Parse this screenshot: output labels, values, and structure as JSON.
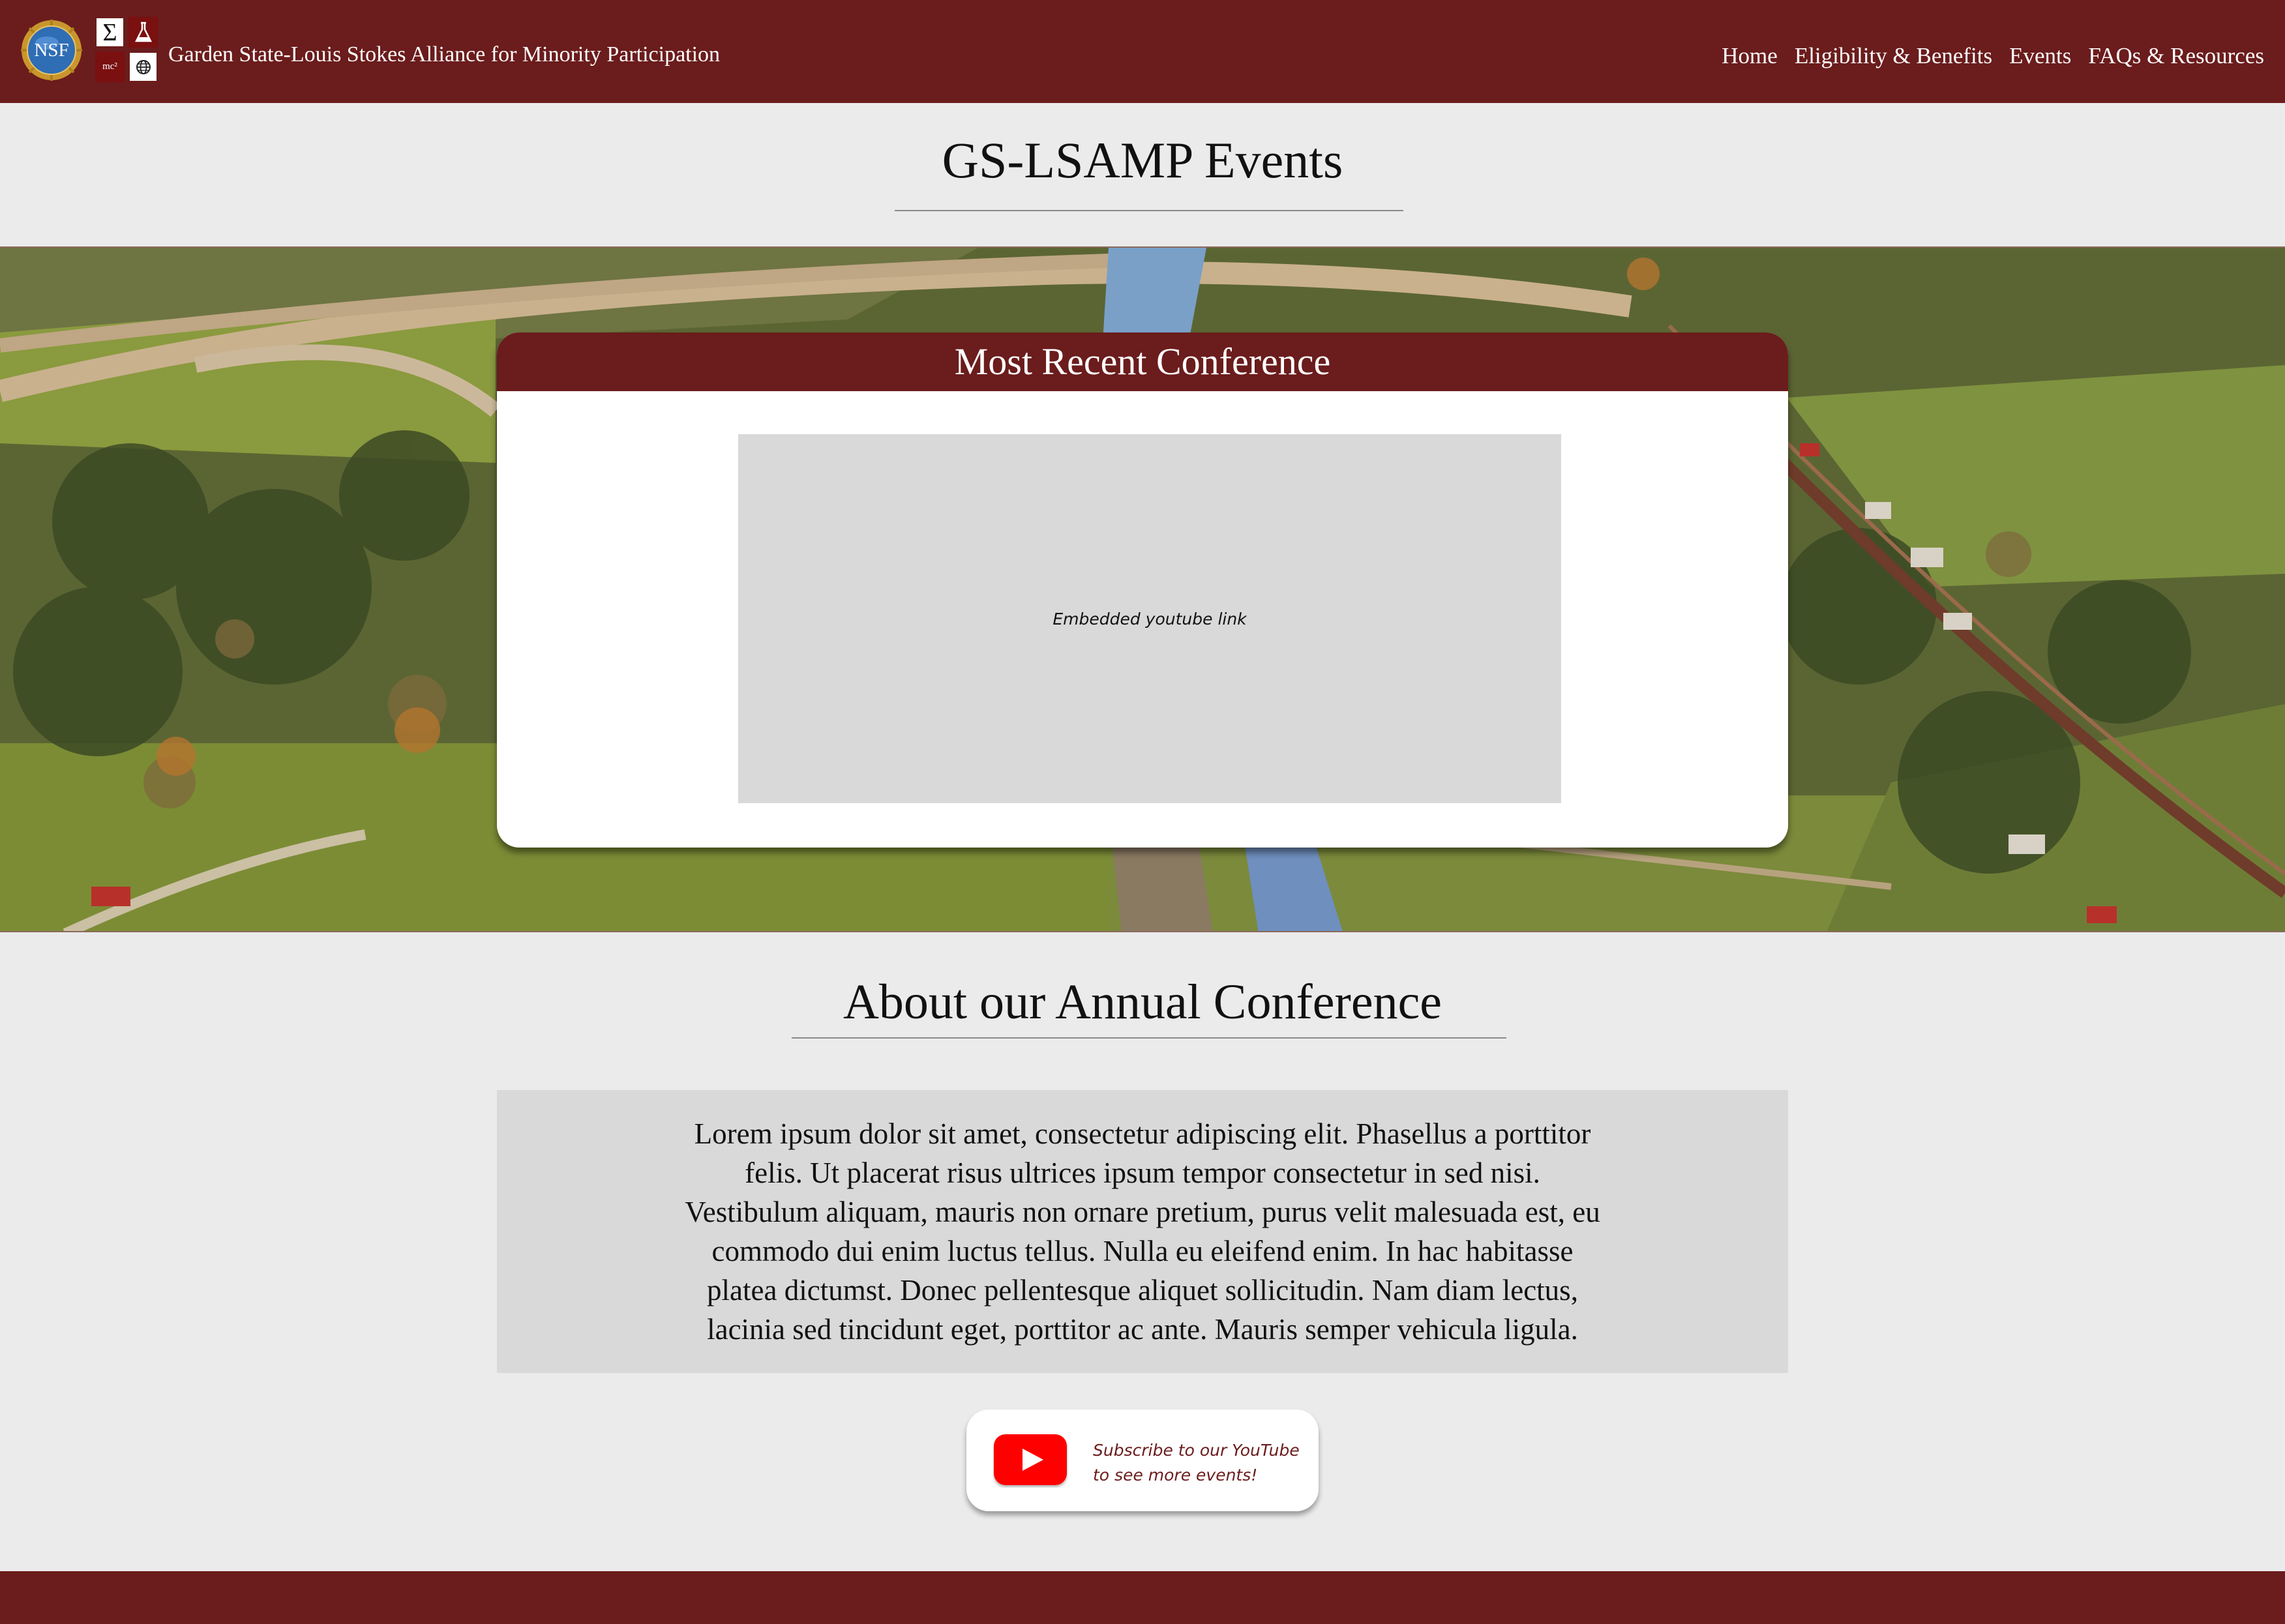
{
  "header": {
    "nsf_logo_text": "NSF",
    "sci_logo": {
      "sigma": "Σ",
      "flask": "⚗",
      "mc2": "mc²",
      "globe": "⊕"
    },
    "title": "Garden State-Louis Stokes Alliance for Minority Participation",
    "nav": [
      "Home",
      "Eligibility & Benefits",
      "Events",
      "FAQs & Resources"
    ]
  },
  "page_title": "GS-LSAMP Events",
  "recent_conference": {
    "heading": "Most Recent Conference",
    "video_placeholder": "Embedded youtube link"
  },
  "about": {
    "heading": "About our Annual Conference",
    "body": "Lorem ipsum dolor sit amet, consectetur adipiscing elit. Phasellus a porttitor felis. Ut placerat risus ultrices ipsum tempor consectetur in sed nisi. Vestibulum aliquam, mauris non ornare pretium, purus velit malesuada est, eu commodo dui enim luctus tellus. Nulla eu eleifend enim. In hac habitasse platea dictumst. Donec pellentesque aliquet sollicitudin. Nam diam lectus, lacinia sed tincidunt eget, porttitor ac ante. Mauris semper vehicula ligula."
  },
  "youtube_cta": {
    "icon": "youtube-play-icon",
    "line1": "Subscribe to our YouTube",
    "line2": "to see more events!"
  },
  "colors": {
    "brand_maroon": "#6b1c1c",
    "page_background": "#ebebeb",
    "panel_gray": "#d9d9d9",
    "youtube_red": "#ff0000"
  }
}
